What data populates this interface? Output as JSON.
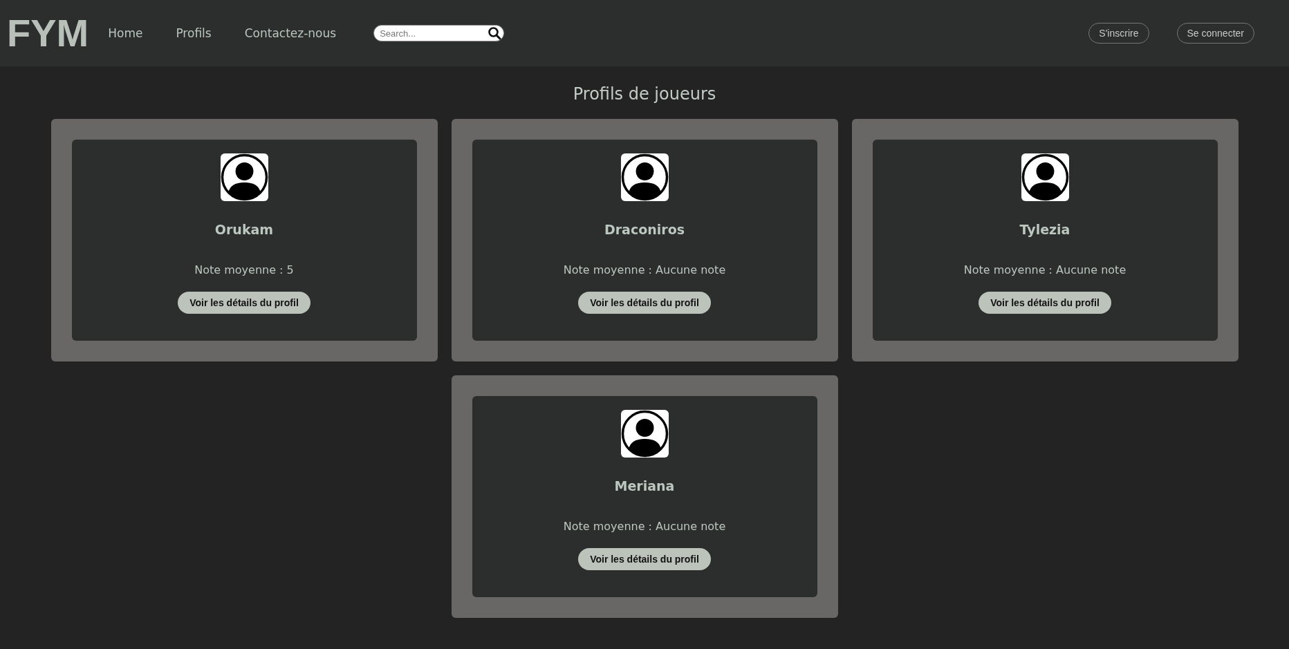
{
  "header": {
    "logo": "FYM",
    "nav": [
      {
        "label": "Home"
      },
      {
        "label": "Profils"
      },
      {
        "label": "Contactez-nous"
      }
    ],
    "search": {
      "placeholder": "Search..."
    },
    "buttons": [
      {
        "label": "S'inscrire"
      },
      {
        "label": "Se connecter"
      }
    ]
  },
  "title": "Profils de joueurs",
  "profiles": [
    {
      "name": "Orukam",
      "rating": "Note moyenne : 5",
      "button": "Voir les détails du profil"
    },
    {
      "name": "Draconiros",
      "rating": "Note moyenne : Aucune note",
      "button": "Voir les détails du profil"
    },
    {
      "name": "Tylezia",
      "rating": "Note moyenne : Aucune note",
      "button": "Voir les détails du profil"
    },
    {
      "name": "Meriana",
      "rating": "Note moyenne : Aucune note",
      "button": "Voir les détails du profil"
    }
  ]
}
